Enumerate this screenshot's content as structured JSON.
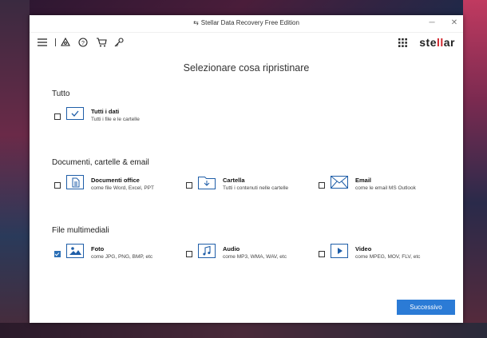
{
  "window": {
    "title": "Stellar Data Recovery Free Edition",
    "minimize": "─",
    "close": "✕"
  },
  "toolbar": {
    "icons": [
      "menu-icon",
      "recover-icon",
      "help-icon",
      "cart-icon",
      "key-icon"
    ],
    "apps_icon": "grid-icon",
    "brand_pre": "ste",
    "brand_mid": "ll",
    "brand_post": "ar"
  },
  "heading": "Selezionare cosa ripristinare",
  "sections": {
    "all": {
      "title": "Tutto",
      "items": [
        {
          "label": "Tutti i dati",
          "desc": "Tutti i file e le cartelle",
          "checked": false,
          "icon": "checkbox-icon"
        }
      ]
    },
    "docs": {
      "title": "Documenti, cartelle & email",
      "items": [
        {
          "label": "Documenti office",
          "desc": "come file Word, Excel, PPT",
          "checked": false,
          "icon": "document-icon"
        },
        {
          "label": "Cartella",
          "desc": "Tutti i contenuti nelle cartelle",
          "checked": false,
          "icon": "folder-icon"
        },
        {
          "label": "Email",
          "desc": "come le email MS Outlook",
          "checked": false,
          "icon": "email-icon"
        }
      ]
    },
    "media": {
      "title": "File multimediali",
      "items": [
        {
          "label": "Foto",
          "desc": "come JPG, PNG, BMP, etc",
          "checked": true,
          "icon": "photo-icon"
        },
        {
          "label": "Audio",
          "desc": "come MP3, WMA, WAV, etc",
          "checked": false,
          "icon": "music-icon"
        },
        {
          "label": "Video",
          "desc": "come MPEG, MOV, FLV, etc",
          "checked": false,
          "icon": "video-icon"
        }
      ]
    }
  },
  "next_button": "Successivo",
  "colors": {
    "accent": "#2b7bd6",
    "icon": "#1f5ea8",
    "brand_red": "#d0242b"
  }
}
